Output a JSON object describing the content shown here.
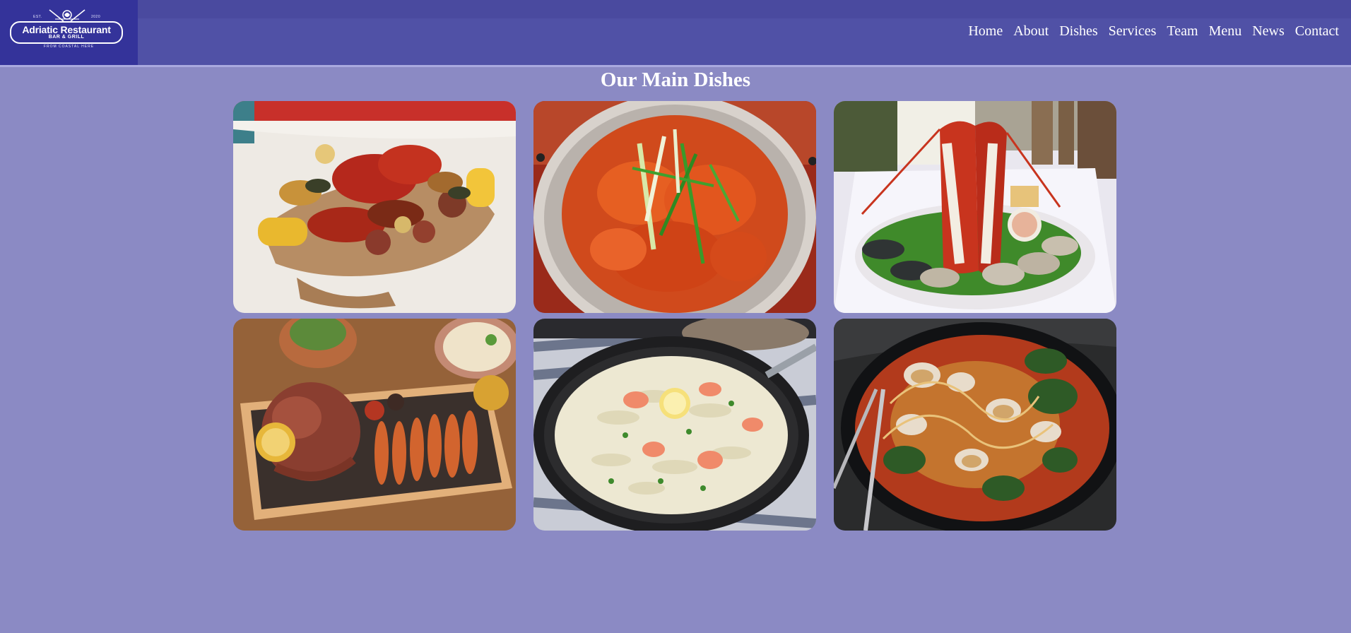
{
  "brand": {
    "name": "Adriatic Restaurant",
    "sub": "BAR & GRILL",
    "est_left": "EST.",
    "est_right": "2020",
    "tagline": "FROM COASTAL HERE"
  },
  "nav": {
    "items": [
      "Home",
      "About",
      "Dishes",
      "Services",
      "Team",
      "Menu",
      "News",
      "Contact"
    ]
  },
  "dishes": {
    "title": "Our Main Dishes",
    "images": [
      {
        "icon": "seafood-boil-photo"
      },
      {
        "icon": "crawfish-pan-photo"
      },
      {
        "icon": "lobster-platter-photo"
      },
      {
        "icon": "octopus-grill-board-photo"
      },
      {
        "icon": "shrimp-pasta-skillet-photo"
      },
      {
        "icon": "clam-spaghetti-pan-photo"
      }
    ]
  },
  "colors": {
    "page_bg": "#8b8ac4",
    "header_bg": "#5051a6",
    "logo_bg": "#34339a",
    "text": "#ffffff"
  }
}
